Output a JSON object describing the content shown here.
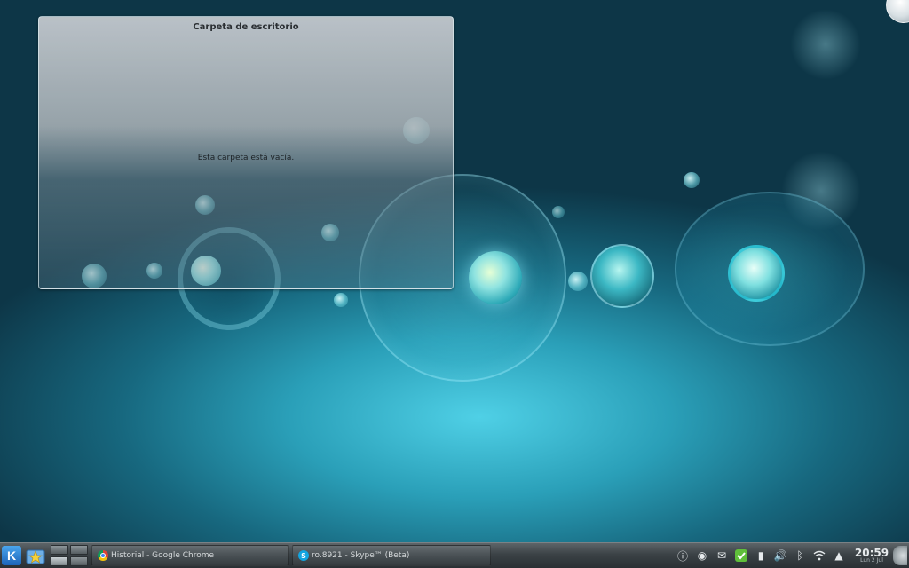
{
  "desktop": {
    "folder_widget": {
      "title": "Carpeta de escritorio",
      "empty_message": "Esta carpeta está vacía."
    },
    "corner_toolbox_icon": "cashew-icon"
  },
  "taskbar": {
    "launcher_icon": "kde-launcher-icon",
    "favorites_icon": "star-folder-icon",
    "tasks": [
      {
        "label": "Historial - Google Chrome",
        "icon": "chrome-icon"
      },
      {
        "label": "ro.8921 - Skype™ (Beta)",
        "icon": "skype-icon"
      }
    ],
    "tray": {
      "clock_time": "20:59",
      "clock_date": "Lun 2 Jul"
    }
  },
  "colors": {
    "accent": "#2a9fb8",
    "taskbar_bg": "#3b4246"
  }
}
